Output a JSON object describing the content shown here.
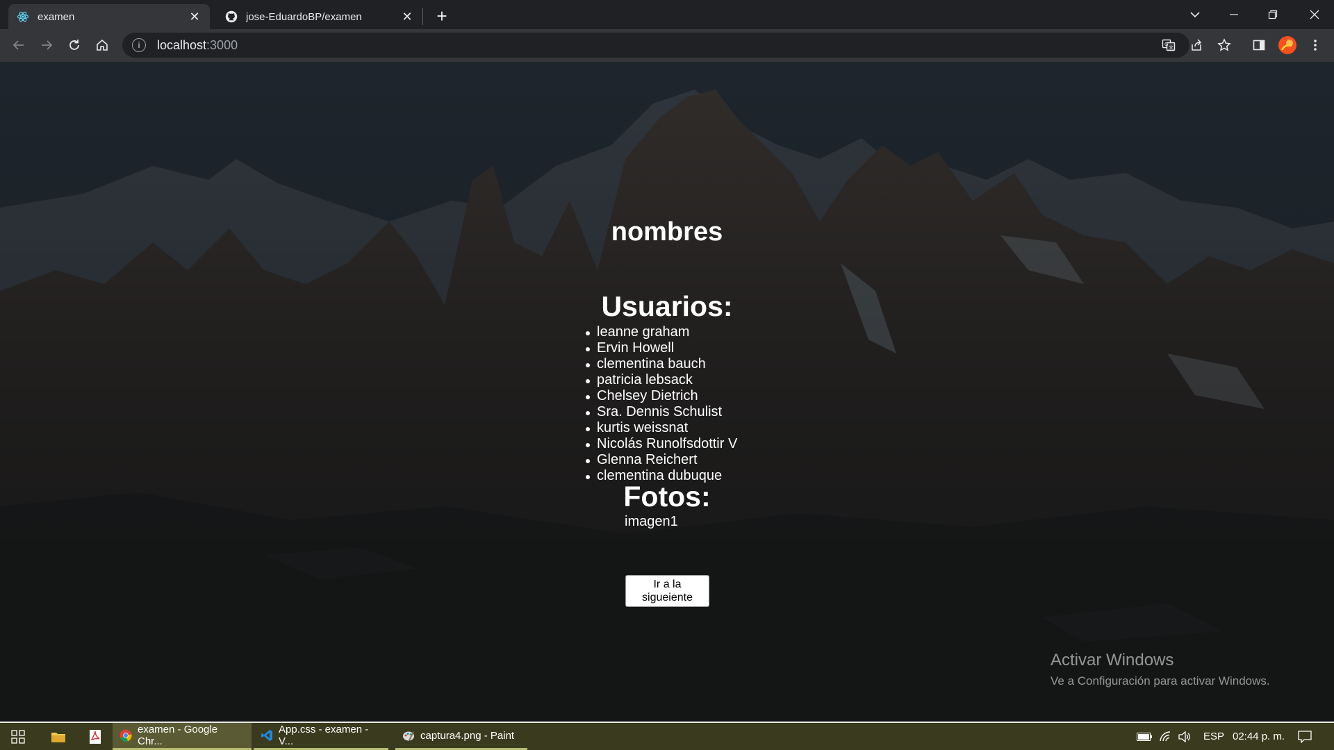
{
  "browser": {
    "tabs": [
      {
        "title": "examen",
        "icon": "react-icon",
        "active": true
      },
      {
        "title": "jose-EduardoBP/examen",
        "icon": "github-icon",
        "active": false
      }
    ],
    "new_tab_symbol": "+",
    "address": {
      "host": "localhost",
      "port": ":3000"
    }
  },
  "page": {
    "heading": "nombres",
    "users_heading": "Usuarios:",
    "users": [
      "leanne graham",
      "Ervin Howell",
      "clementina bauch",
      "patricia lebsack",
      "Chelsey Dietrich",
      "Sra. Dennis Schulist",
      "kurtis weissnat",
      "Nicolás Runolfsdottir V",
      "Glenna Reichert",
      "clementina dubuque"
    ],
    "photos_heading": "Fotos:",
    "photo_alt": "imagen1",
    "next_button": "Ir a la sigueiente"
  },
  "watermark": {
    "title": "Activar Windows",
    "subtitle": "Ve a Configuración para activar Windows."
  },
  "taskbar": {
    "apps": [
      {
        "label": "examen - Google Chr...",
        "icon": "chrome-icon",
        "active": true
      },
      {
        "label": "App.css - examen - V...",
        "icon": "vscode-icon",
        "active": false
      },
      {
        "label": "captura4.png - Paint",
        "icon": "paint-icon",
        "active": false
      }
    ],
    "language": "ESP",
    "time": "02:44 p. m."
  },
  "colors": {
    "tabstrip": "#202124",
    "toolbar": "#35363a",
    "taskbar": "#3a3b1e",
    "text": "#ffffff"
  }
}
